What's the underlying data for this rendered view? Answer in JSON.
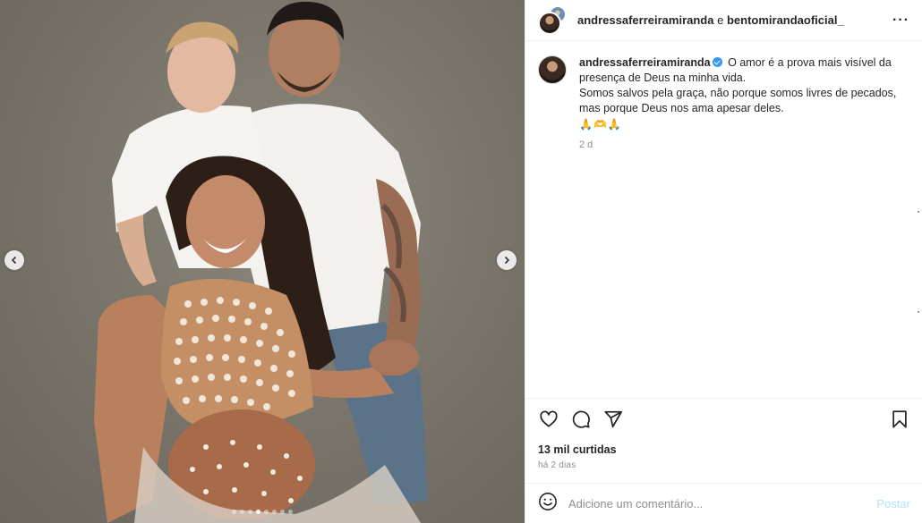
{
  "post": {
    "header_user": "andressaferreiramiranda",
    "header_connector": " e ",
    "header_collab": "bentomirandaoficial_",
    "caption_user": "andressaferreiramiranda",
    "caption_line1": "O amor é a prova mais visível da presença de Deus na minha vida.",
    "caption_line2": "Somos salvos pela graça, não porque somos livres de pecados, mas porque Deus nos ama apesar deles.",
    "caption_emojis": "🙏🫶🙏",
    "caption_time": "2 d",
    "likes": "13 mil curtidas",
    "posted_time": "há 2 dias"
  },
  "comment": {
    "placeholder": "Adicione um comentário...",
    "post_label": "Postar"
  },
  "carousel": {
    "total_slides": 8,
    "active_index": 3
  },
  "icons": {
    "more": "more-horizontal-icon",
    "like": "heart-icon",
    "comment": "comment-bubble-icon",
    "share": "paper-plane-icon",
    "save": "bookmark-icon",
    "emoji": "smiley-icon",
    "prev": "chevron-left-icon",
    "next": "chevron-right-icon"
  },
  "colors": {
    "verified": "#3897f0",
    "post_button": "#b2dffc",
    "muted_text": "#8e8e8e"
  }
}
